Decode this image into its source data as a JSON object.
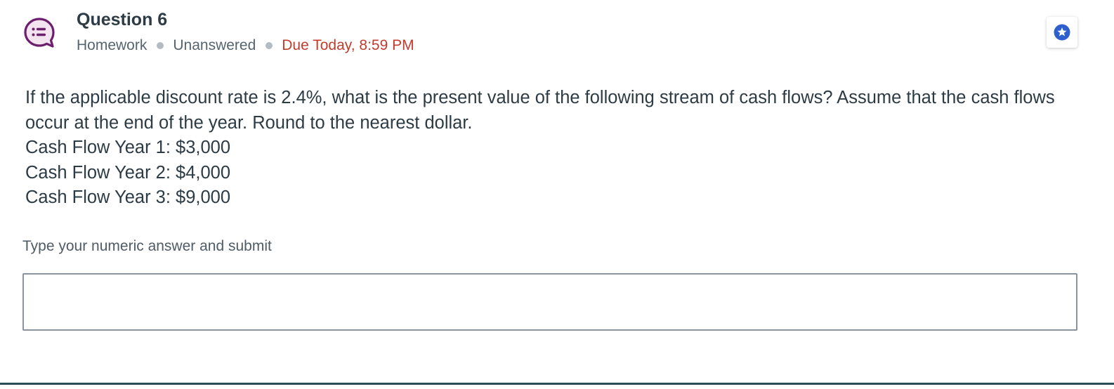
{
  "header": {
    "title": "Question 6",
    "meta": {
      "type": "Homework",
      "status": "Unanswered",
      "due": "Due Today, 8:59 PM"
    },
    "icons": {
      "question_type_icon": "discussion-list-icon",
      "star_icon": "star-icon"
    }
  },
  "question": {
    "prompt": "If the applicable discount rate is 2.4%, what is the present value of the following stream of cash flows? Assume that the cash flows occur at the end of the year. Round to the nearest dollar.",
    "cash_flows": [
      "Cash Flow Year 1: $3,000",
      "Cash Flow Year 2: $4,000",
      "Cash Flow Year 3: $9,000"
    ]
  },
  "answer": {
    "label": "Type your numeric answer and submit",
    "value": "",
    "placeholder": ""
  },
  "colors": {
    "accent_purple": "#6b1f6d",
    "due_red": "#c23c2d",
    "star_blue": "#2f5fcd",
    "text_dark": "#2d3b45",
    "text_muted": "#566470",
    "separator_dot": "#b4bcc3"
  }
}
